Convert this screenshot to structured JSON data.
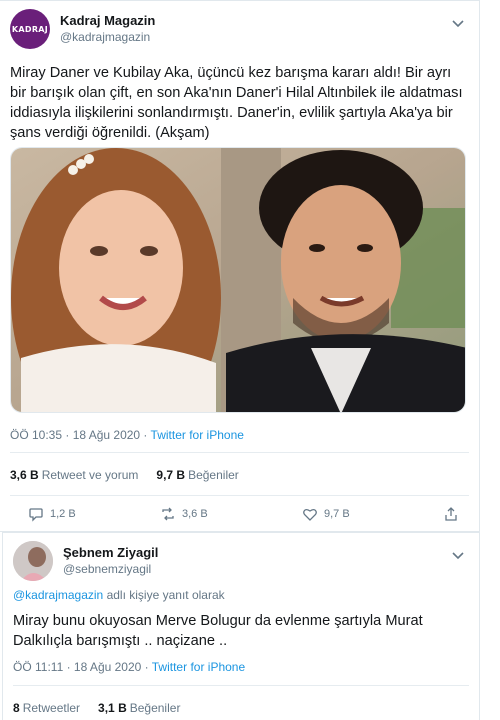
{
  "main_tweet": {
    "avatar_text": "KADRAJ",
    "name": "Kadraj Magazin",
    "handle": "@kadrajmagazin",
    "text": "Miray Daner ve Kubilay Aka, üçüncü kez barışma kararı aldı! Bir ayrı bir barışık olan çift, en son Aka'nın Daner'i Hilal Altınbilek ile aldatması iddiasıyla ilişkilerini sonlandırmıştı. Daner'in, evlilik şartıyla Aka'ya bir şans verdiği öğrenildi. (Akşam)",
    "time": "ÖÖ 10:35 · 18 Ağu 2020 · ",
    "source": "Twitter for iPhone",
    "retweet_count": "3,6 B",
    "retweet_label": "Retweet ve yorum",
    "like_count": "9,7 B",
    "like_label": "Beğeniler",
    "action_reply": "1,2 B",
    "action_retweet": "3,6 B",
    "action_like": "9,7 B"
  },
  "reply_tweet": {
    "name": "Şebnem Ziyagil",
    "handle": "@sebnemziyagil",
    "reply_to_handle": "@kadrajmagazin",
    "reply_to_suffix": " adlı kişiye yanıt olarak",
    "text": "Miray bunu okuyosan Merve Bolugur da evlenme şartıyla Murat Dalkılıçla barışmıştı .. naçizane ..",
    "time": "ÖÖ 11:11 · 18 Ağu 2020 · ",
    "source": "Twitter for iPhone",
    "retweet_count": "8",
    "retweet_label": "Retweetler",
    "like_count": "3,1 B",
    "like_label": "Beğeniler"
  },
  "colors": {
    "link": "#1b95e0",
    "muted": "#657786",
    "text": "#14171a",
    "border": "#e1e8ed",
    "kadraj_brand": "#6a1f7a"
  },
  "icons": [
    "chevron-down-icon",
    "reply-icon",
    "retweet-icon",
    "like-icon",
    "share-icon"
  ]
}
